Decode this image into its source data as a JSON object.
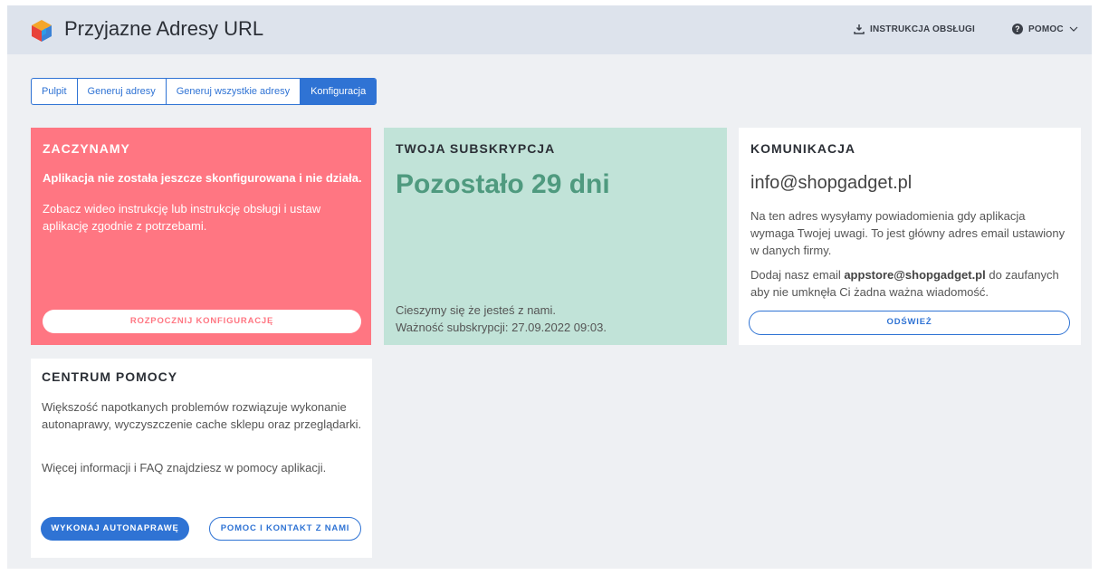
{
  "app": {
    "title": "Przyjazne Adresy URL"
  },
  "header": {
    "instruction_label": "INSTRUKCJA OBSŁUGI",
    "help_label": "POMOC"
  },
  "tabs": [
    {
      "label": "Pulpit"
    },
    {
      "label": "Generuj adresy"
    },
    {
      "label": "Generuj wszystkie adresy"
    },
    {
      "label": "Konfiguracja",
      "active": true
    }
  ],
  "cards": {
    "start": {
      "title": "ZACZYNAMY",
      "lead": "Aplikacja nie została jeszcze skonfigurowana i nie działa.",
      "desc": "Zobacz wideo instrukcję lub instrukcję obsługi i ustaw aplikację zgodnie z potrzebami.",
      "button": "ROZPOCZNIJ KONFIGURACJĘ"
    },
    "subscription": {
      "title": "TWOJA SUBSKRYPCJA",
      "remaining": "Pozostało 29 dni",
      "line1": "Cieszymy się że jesteś z nami.",
      "line2": "Ważność subskrypcji: 27.09.2022 09:03."
    },
    "communication": {
      "title": "KOMUNIKACJA",
      "email": "info@shopgadget.pl",
      "p1": "Na ten adres wysyłamy powiadomienia gdy aplikacja wymaga Twojej uwagi. To jest główny adres email ustawiony w danych firmy.",
      "p2_before": "Dodaj nasz email ",
      "p2_email": "appstore@shopgadget.pl",
      "p2_after": " do zaufanych aby nie umknęła Ci żadna ważna wiadomość.",
      "button": "ODŚWIEŻ"
    },
    "help": {
      "title": "CENTRUM POMOCY",
      "p1": "Większość napotkanych problemów rozwiązuje wykonanie autonaprawy, wyczyszczenie cache sklepu oraz przeglądarki.",
      "p2": "Więcej informacji i FAQ znajdziesz w pomocy aplikacji.",
      "button_primary": "WYKONAJ AUTONAPRAWĘ",
      "button_secondary": "POMOC I KONTAKT Z NAMI"
    }
  },
  "colors": {
    "accent": "#2f73d4",
    "start_bg": "#ff7682",
    "sub_bg": "#c1e3d8",
    "sub_text": "#4f9a7f"
  }
}
